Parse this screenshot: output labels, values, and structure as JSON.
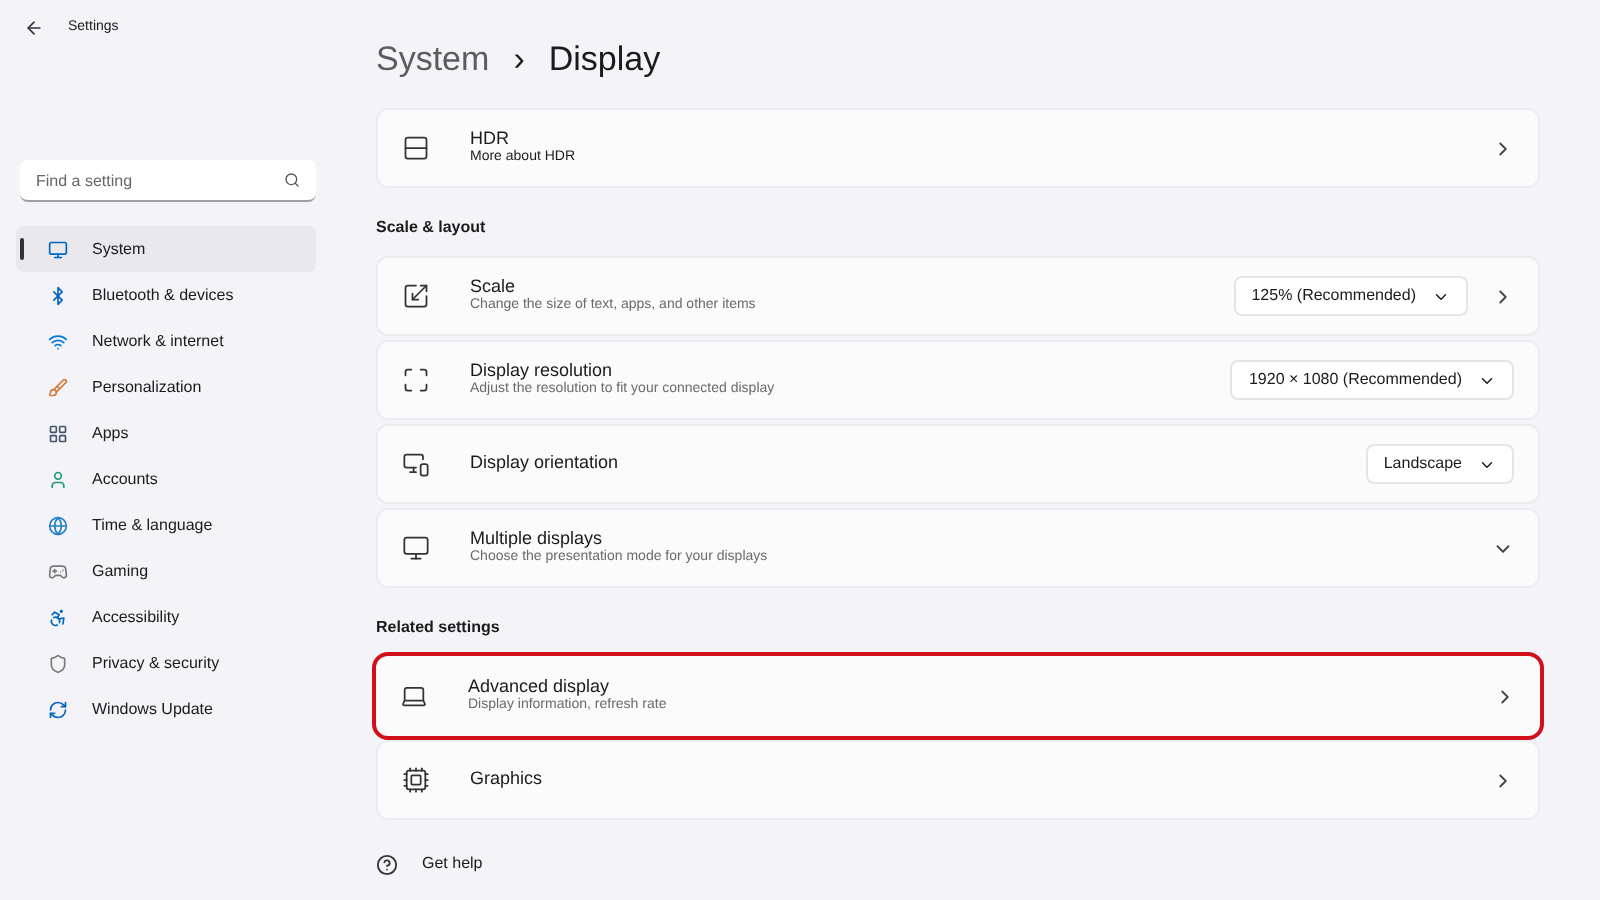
{
  "window": {
    "title": "Settings"
  },
  "search": {
    "placeholder": "Find a setting"
  },
  "sidebar": {
    "items": [
      {
        "label": "System",
        "selected": true
      },
      {
        "label": "Bluetooth & devices",
        "selected": false
      },
      {
        "label": "Network & internet",
        "selected": false
      },
      {
        "label": "Personalization",
        "selected": false
      },
      {
        "label": "Apps",
        "selected": false
      },
      {
        "label": "Accounts",
        "selected": false
      },
      {
        "label": "Time & language",
        "selected": false
      },
      {
        "label": "Gaming",
        "selected": false
      },
      {
        "label": "Accessibility",
        "selected": false
      },
      {
        "label": "Privacy & security",
        "selected": false
      },
      {
        "label": "Windows Update",
        "selected": false
      }
    ]
  },
  "breadcrumb": {
    "parent": "System",
    "separator": "›",
    "current": "Display"
  },
  "sections": [
    {
      "rows": [
        {
          "kind": "link",
          "title": "HDR",
          "subtitle": "More about HDR",
          "subtitle_strong": true,
          "highlighted": false
        }
      ]
    },
    {
      "heading": "Scale & layout",
      "rows": [
        {
          "kind": "dropdown_link",
          "title": "Scale",
          "subtitle": "Change the size of text, apps, and other items",
          "value": "125% (Recommended)",
          "highlighted": false
        },
        {
          "kind": "dropdown",
          "title": "Display resolution",
          "subtitle": "Adjust the resolution to fit your connected display",
          "value": "1920 × 1080 (Recommended)",
          "highlighted": false
        },
        {
          "kind": "dropdown",
          "title": "Display orientation",
          "value": "Landscape",
          "highlighted": false
        },
        {
          "kind": "expand",
          "title": "Multiple displays",
          "subtitle": "Choose the presentation mode for your displays",
          "highlighted": false
        }
      ]
    },
    {
      "heading": "Related settings",
      "rows": [
        {
          "kind": "link",
          "title": "Advanced display",
          "subtitle": "Display information, refresh rate",
          "highlighted": true
        },
        {
          "kind": "link",
          "title": "Graphics",
          "highlighted": false
        }
      ]
    }
  ],
  "help": {
    "label": "Get help"
  }
}
